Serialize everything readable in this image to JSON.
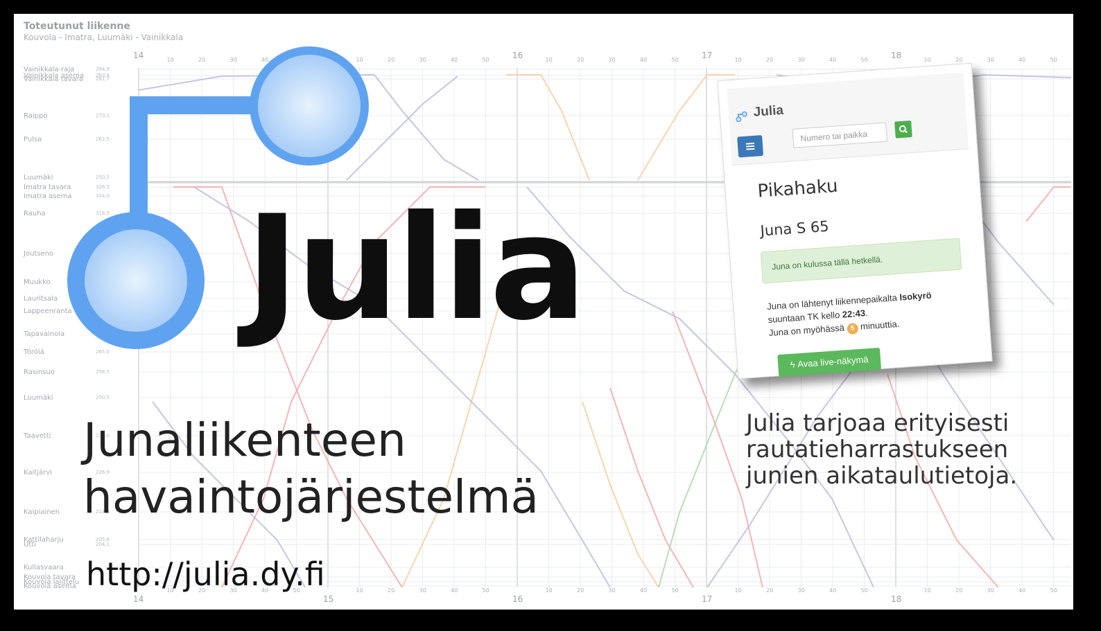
{
  "chart": {
    "title": "Toteutunut liikenne",
    "subtitle": "Kouvola - Imatra, Luumäki - Vainikkala",
    "hours": [
      "14",
      "15",
      "16",
      "17",
      "18"
    ],
    "minutes": [
      "10",
      "20",
      "30",
      "40",
      "50"
    ],
    "stations": [
      {
        "name": "Vainikkala-raja",
        "km": "284,9"
      },
      {
        "name": "Vainikkala asema",
        "km": "283,8"
      },
      {
        "name": "Vainikkala tavara",
        "km": "281,7"
      },
      {
        "name": "Raippo",
        "km": "270,1"
      },
      {
        "name": "Pulsa",
        "km": "262,5"
      },
      {
        "name": "Luumäki",
        "km": "250,5"
      },
      {
        "name": "Imatra tavara",
        "km": "326,5"
      },
      {
        "name": "Imatra asema",
        "km": "324,0"
      },
      {
        "name": "Rauha",
        "km": "318,5"
      },
      {
        "name": "Joutseno",
        "km": ""
      },
      {
        "name": "Muukko",
        "km": ""
      },
      {
        "name": "Lauritsala",
        "km": ""
      },
      {
        "name": "Lappeenranta",
        "km": ""
      },
      {
        "name": "Tapavainola",
        "km": ""
      },
      {
        "name": "Törölä",
        "km": "265,0"
      },
      {
        "name": "Rasinsuo",
        "km": "258,5"
      },
      {
        "name": "Luumäki",
        "km": "250,5"
      },
      {
        "name": "Taavetti",
        "km": "238,0"
      },
      {
        "name": "Kaitjärvi",
        "km": "226,9"
      },
      {
        "name": "Kaipiainen",
        "km": "214,3"
      },
      {
        "name": "Kattilaharju",
        "km": "205,6"
      },
      {
        "name": "Utti",
        "km": "204,1"
      },
      {
        "name": "Kullasvaara",
        "km": ""
      },
      {
        "name": "Kouvola tavara",
        "km": ""
      },
      {
        "name": "Kouvola lajittelu",
        "km": ""
      },
      {
        "name": "Kouvola asema",
        "km": ""
      }
    ]
  },
  "logo": {
    "name": "Julia",
    "tagline_line1": "Junaliikenteen",
    "tagline_line2": "havaintojärjestelmä",
    "url": "http://julia.dy.fi"
  },
  "description": {
    "line1": "Julia tarjoaa erityisesti",
    "line2": "rautatieharrastukseen",
    "line3": "junien aikataulutietoja."
  },
  "app": {
    "brand": "Julia",
    "search_placeholder": "Numero tai paikka",
    "page_heading": "Pikahaku",
    "train_heading": "Juna S 65",
    "alert_text": "Juna on kulussa tällä hetkellä.",
    "info_prefix": "Juna on lähtenyt liikennepaikalta ",
    "info_station": "Isokyrö",
    "info_middle": " suuntaan TK kello ",
    "info_time": "22:43",
    "info_suffix": ".",
    "delay_prefix": "Juna on myöhässä ",
    "delay_minutes": "5",
    "delay_suffix": " minuuttia.",
    "live_button": "Avaa live-näkymä"
  },
  "colors": {
    "logo_blue": "#5fa3f0",
    "logo_blue_light": "#c8e2fb",
    "menu_blue": "#3a78b8",
    "green_button": "#5cb85c",
    "badge_orange": "#f0ad4e"
  }
}
